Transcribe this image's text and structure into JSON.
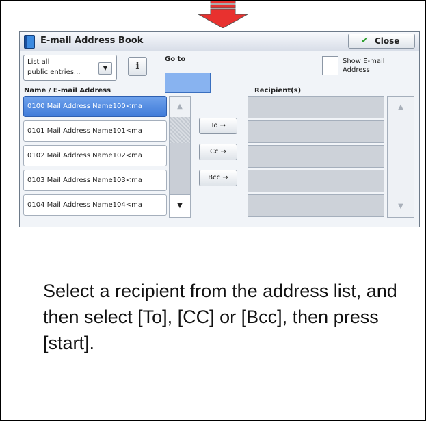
{
  "dialog": {
    "title": "E-mail Address Book",
    "close_label": "Close"
  },
  "filter": {
    "line1": "List all",
    "line2": "public entries..."
  },
  "goto": {
    "label": "Go to"
  },
  "show_email": {
    "line1": "Show E-mail",
    "line2": "Address"
  },
  "headers": {
    "name": "Name / E-mail Address",
    "recipients": "Recipient(s)"
  },
  "entries": [
    {
      "label": "0100  Mail Address Name100<ma",
      "selected": true
    },
    {
      "label": "0101  Mail Address Name101<ma",
      "selected": false
    },
    {
      "label": "0102  Mail Address Name102<ma",
      "selected": false
    },
    {
      "label": "0103  Mail Address Name103<ma",
      "selected": false
    },
    {
      "label": "0104  Mail Address Name104<ma",
      "selected": false
    }
  ],
  "actions": {
    "to": "To →",
    "cc": "Cc →",
    "bcc": "Bcc →"
  },
  "instruction": "Select a recipient from the address list, and then select [To], [CC] or [Bcc], then press [start].",
  "colors": {
    "arrow": "#e8312f",
    "selected": "#4a86e0",
    "goto": "#88b3f0"
  }
}
